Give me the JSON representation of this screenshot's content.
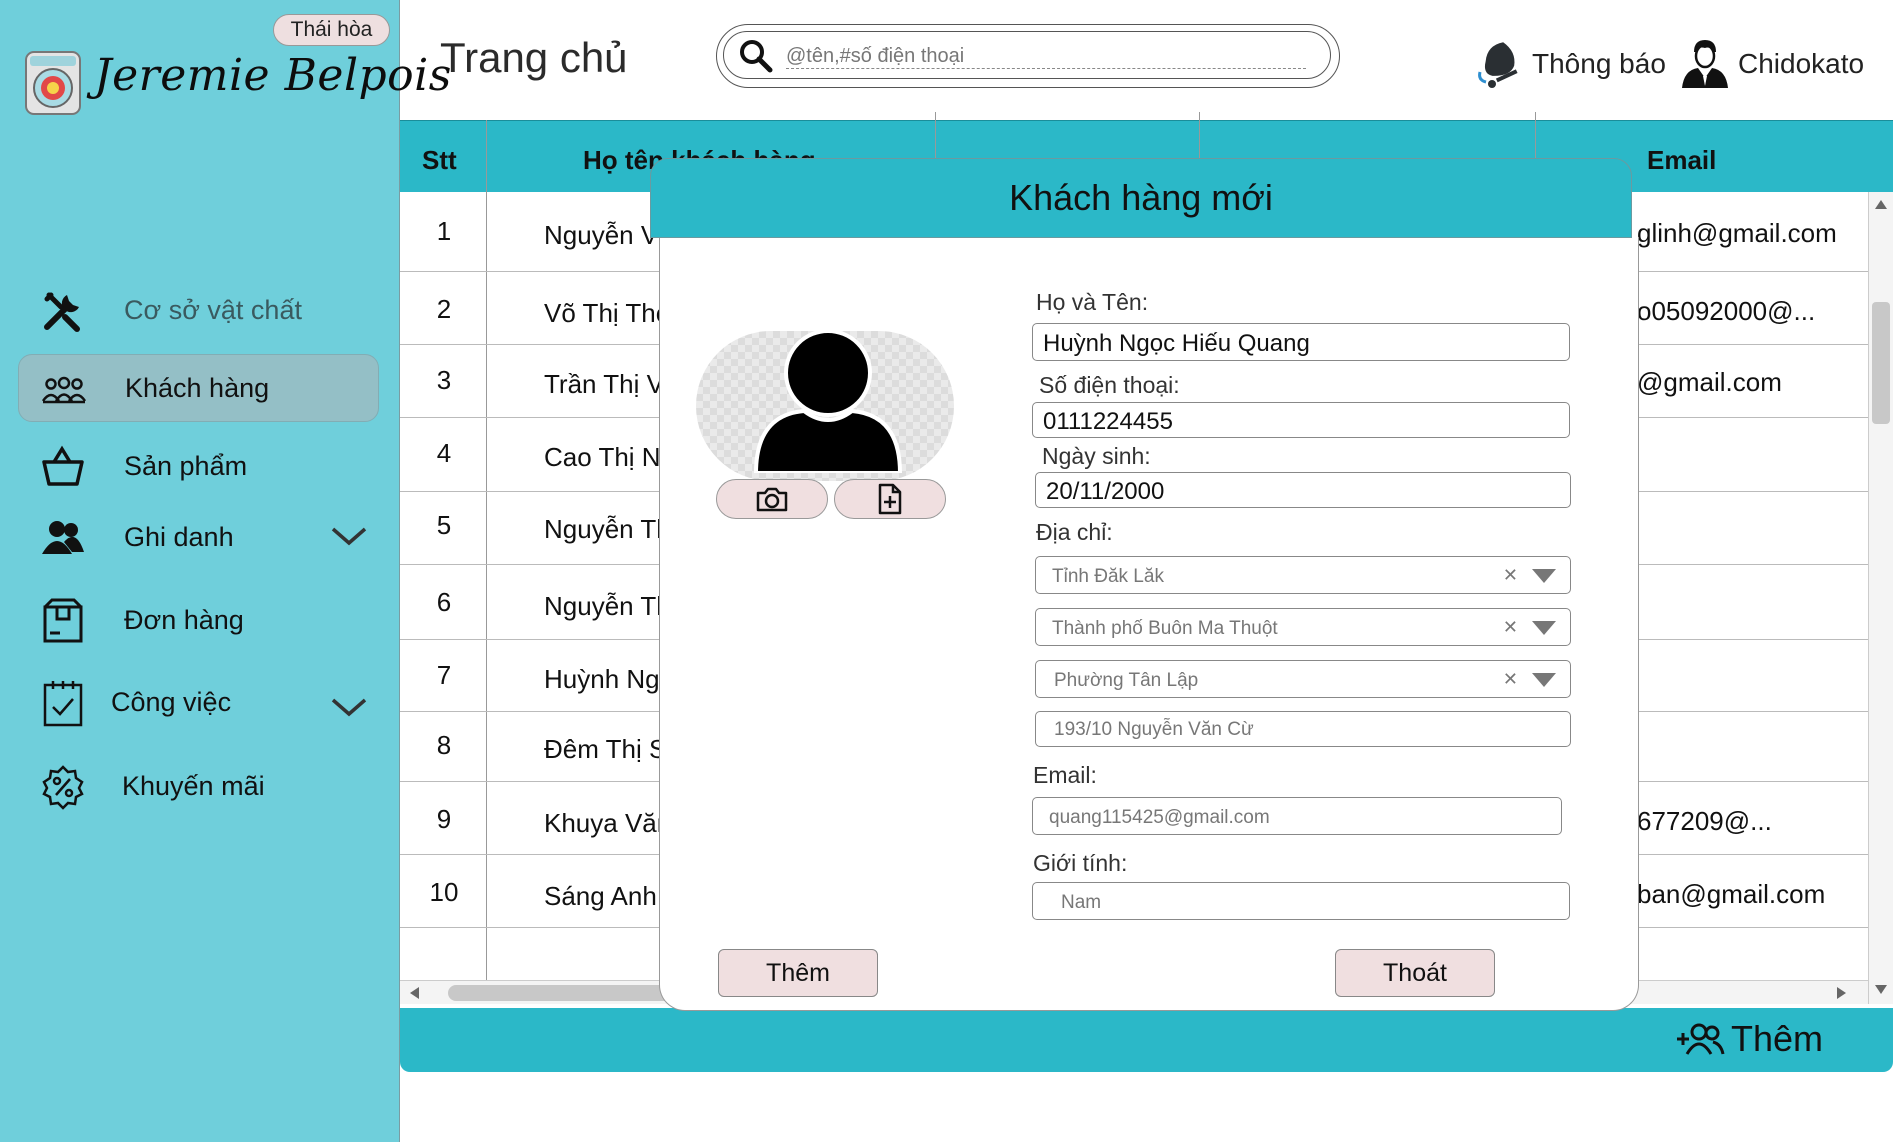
{
  "sidebar": {
    "branch": "Thái hòa",
    "brand": "Jeremie Belpois",
    "items": [
      {
        "label": "Cơ sở vật chất",
        "icon": "tools-icon"
      },
      {
        "label": "Khách hàng",
        "icon": "customers-icon"
      },
      {
        "label": "Sản phẩm",
        "icon": "basket-icon"
      },
      {
        "label": "Ghi danh",
        "icon": "users-icon"
      },
      {
        "label": "Đơn hàng",
        "icon": "package-icon"
      },
      {
        "label": "Công việc",
        "icon": "calendar-check-icon"
      },
      {
        "label": "Khuyến mãi",
        "icon": "discount-badge-icon"
      }
    ]
  },
  "header": {
    "title": "Trang chủ",
    "search_placeholder": "@tên,#số điện thoại",
    "notifications_label": "Thông báo",
    "user_name": "Chidokato"
  },
  "table": {
    "columns": [
      "Stt",
      "Họ tên khách hàng",
      "Email"
    ],
    "rows": [
      {
        "stt": "1",
        "name": "Nguyễn Vă",
        "email": "glinh@gmail.com"
      },
      {
        "stt": "2",
        "name": "Võ Thị Tho",
        "email": "o05092000@..."
      },
      {
        "stt": "3",
        "name": "Trần Thị V",
        "email": "@gmail.com"
      },
      {
        "stt": "4",
        "name": "Cao Thị N",
        "email": ""
      },
      {
        "stt": "5",
        "name": "Nguyễn Th",
        "email": ""
      },
      {
        "stt": "6",
        "name": "Nguyễn Th",
        "email": ""
      },
      {
        "stt": "7",
        "name": "Huỳnh Ng",
        "email": ""
      },
      {
        "stt": "8",
        "name": "Đêm Thị S",
        "email": ""
      },
      {
        "stt": "9",
        "name": "Khuya Văn",
        "email": "677209@..."
      },
      {
        "stt": "10",
        "name": "Sáng Anh",
        "email": "ban@gmail.com"
      }
    ],
    "add_label": "Thêm"
  },
  "modal": {
    "title": "Khách hàng mới",
    "name_label": "Họ và Tên:",
    "name_value": "Huỳnh Ngọc Hiếu Quang",
    "phone_label": "Số điện thoại:",
    "phone_value": "0111224455",
    "dob_label": "Ngày sinh:",
    "dob_value": "20/11/2000",
    "address_label": "Địa chỉ:",
    "province": "Tỉnh Đăk Lăk",
    "city": "Thành phố Buôn Ma Thuột",
    "ward": "Phường Tân  Lập",
    "street_placeholder": "193/10 Nguyễn Văn Cừ",
    "email_label": "Email:",
    "email_placeholder": "quang115425@gmail.com",
    "gender_label": "Giới tính:",
    "gender_placeholder": "Nam",
    "add_button": "Thêm",
    "exit_button": "Thoát"
  },
  "colors": {
    "sidebar_bg": "#6fcfdb",
    "accent": "#2bb8c8",
    "button_bg": "#f0dfe0",
    "active_item": "#94bfc6"
  }
}
